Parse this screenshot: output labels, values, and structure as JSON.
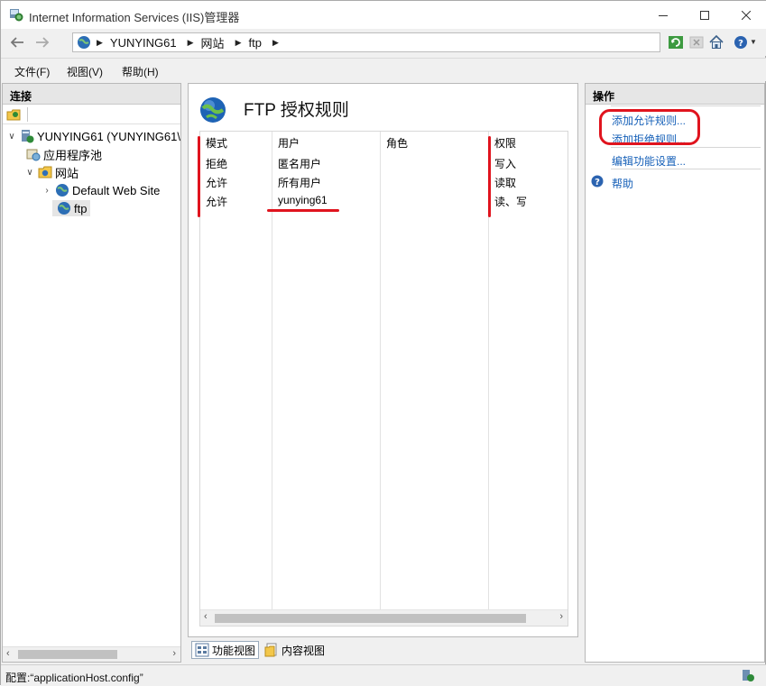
{
  "window": {
    "title": "Internet Information Services (IIS)管理器"
  },
  "address": {
    "crumbs": [
      "YUNYING61",
      "网站",
      "ftp"
    ]
  },
  "menu": {
    "file": "文件(F)",
    "view": "视图(V)",
    "help": "帮助(H)"
  },
  "connections": {
    "heading": "连接",
    "tree": {
      "server": "YUNYING61 (YUNYING61\\",
      "app_pools": "应用程序池",
      "sites": "网站",
      "default_site": "Default Web Site",
      "ftp": "ftp"
    }
  },
  "feature": {
    "title": "FTP 授权规则",
    "columns": [
      "模式",
      "用户",
      "角色",
      "权限"
    ],
    "rows": [
      {
        "mode": "拒绝",
        "user": "匿名用户",
        "role": "",
        "permission": "写入"
      },
      {
        "mode": "允许",
        "user": "所有用户",
        "role": "",
        "permission": "读取"
      },
      {
        "mode": "允许",
        "user": "yunying61",
        "role": "",
        "permission": "读、写"
      }
    ]
  },
  "view_tabs": {
    "features": "功能视图",
    "content": "内容视图"
  },
  "actions": {
    "heading": "操作",
    "add_allow": "添加允许规则...",
    "add_deny": "添加拒绝规则...",
    "edit_settings": "编辑功能设置...",
    "help": "帮助"
  },
  "status": {
    "text": "配置:“applicationHost.config”"
  },
  "colors": {
    "link": "#1660b8",
    "annotation": "#e0141e"
  }
}
